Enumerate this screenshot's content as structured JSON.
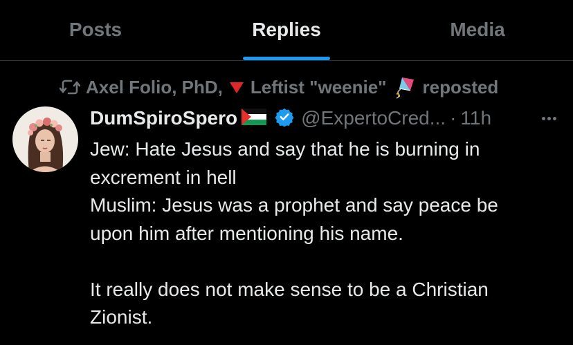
{
  "tabs": [
    {
      "label": "Posts",
      "active": false
    },
    {
      "label": "Replies",
      "active": true
    },
    {
      "label": "Media",
      "active": false
    }
  ],
  "accent_color": "#1d9bf0",
  "repost": {
    "icon": "repost-icon",
    "name_part1": "Axel Folio, PhD,",
    "emoji1": "🔻",
    "name_part2": "Leftist \"weenie\"",
    "emoji2": "🪁",
    "suffix": "reposted"
  },
  "tweet": {
    "avatar": "avatar",
    "display_name": "DumSpiroSpero",
    "flag_icon": "palestine-flag-icon",
    "verified_icon": "verified-badge-icon",
    "handle": "@ExpertoCred...",
    "separator": "·",
    "time": "11h",
    "more_icon": "more-icon",
    "lines": [
      "Jew: Hate Jesus and say that he is burning in",
      "excrement in hell",
      "Muslim: Jesus was a prophet and say peace be",
      "upon him after mentioning his name.",
      "",
      "It really does not make sense to be a Christian",
      "Zionist."
    ]
  }
}
